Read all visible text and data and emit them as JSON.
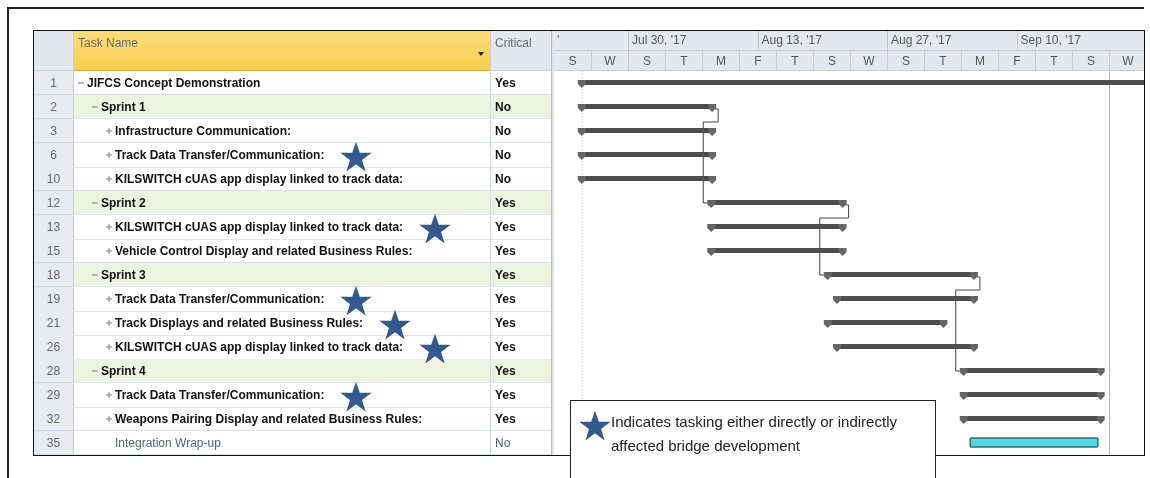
{
  "columns": {
    "task_name": "Task Name",
    "critical": "Critical"
  },
  "tasks": [
    {
      "id": "1",
      "name": "JIFCS Concept Demonstration",
      "critical": "Yes",
      "kind": "summary",
      "expanded": true,
      "children": [
        {
          "id": "2",
          "name": "Sprint 1",
          "critical": "No",
          "kind": "summary",
          "expanded": true,
          "children": [
            {
              "id": "3",
              "name": "Infrastructure Communication:",
              "critical": "No",
              "kind": "summary",
              "expanded": false,
              "starred": false
            },
            {
              "id": "6",
              "name": "Track Data Transfer/Communication:",
              "critical": "No",
              "kind": "summary",
              "expanded": false,
              "starred": true
            },
            {
              "id": "10",
              "name": "KILSWITCH cUAS app display linked to track data:",
              "critical": "No",
              "kind": "summary",
              "expanded": false,
              "starred": false
            }
          ]
        },
        {
          "id": "12",
          "name": "Sprint 2",
          "critical": "Yes",
          "kind": "summary",
          "expanded": true,
          "children": [
            {
              "id": "13",
              "name": "KILSWITCH cUAS app display linked to track data:",
              "critical": "Yes",
              "kind": "summary",
              "expanded": false,
              "starred": true
            },
            {
              "id": "15",
              "name": "Vehicle Control Display and related Business Rules:",
              "critical": "Yes",
              "kind": "summary",
              "expanded": false,
              "starred": false
            }
          ]
        },
        {
          "id": "18",
          "name": "Sprint 3",
          "critical": "Yes",
          "kind": "summary",
          "expanded": true,
          "children": [
            {
              "id": "19",
              "name": "Track Data Transfer/Communication:",
              "critical": "Yes",
              "kind": "summary",
              "expanded": false,
              "starred": true
            },
            {
              "id": "21",
              "name": "Track Displays and related Business Rules:",
              "critical": "Yes",
              "kind": "summary",
              "expanded": false,
              "starred": true
            },
            {
              "id": "26",
              "name": "KILSWITCH cUAS app display linked to track data:",
              "critical": "Yes",
              "kind": "summary",
              "expanded": false,
              "starred": true
            }
          ]
        },
        {
          "id": "28",
          "name": "Sprint 4",
          "critical": "Yes",
          "kind": "summary",
          "expanded": true,
          "children": [
            {
              "id": "29",
              "name": "Track Data Transfer/Communication:",
              "critical": "Yes",
              "kind": "summary",
              "expanded": false,
              "starred": true
            },
            {
              "id": "32",
              "name": "Weapons Pairing Display and related Business Rules:",
              "critical": "Yes",
              "kind": "summary",
              "expanded": false,
              "starred": false
            },
            {
              "id": "35",
              "name": "Integration Wrap-up",
              "critical": "No",
              "kind": "task"
            }
          ]
        }
      ]
    }
  ],
  "timescale": {
    "upper": [
      "'",
      "Jul 30, '17",
      "Aug 13, '17",
      "Aug 27, '17",
      "Sep 10, '17"
    ],
    "lower": [
      "S",
      "W",
      "S",
      "T",
      "M",
      "F",
      "T",
      "S",
      "W",
      "S",
      "T",
      "M",
      "F",
      "T",
      "S",
      "W"
    ]
  },
  "legend": {
    "text": "Indicates tasking either directly or indirectly affected bridge development"
  }
}
